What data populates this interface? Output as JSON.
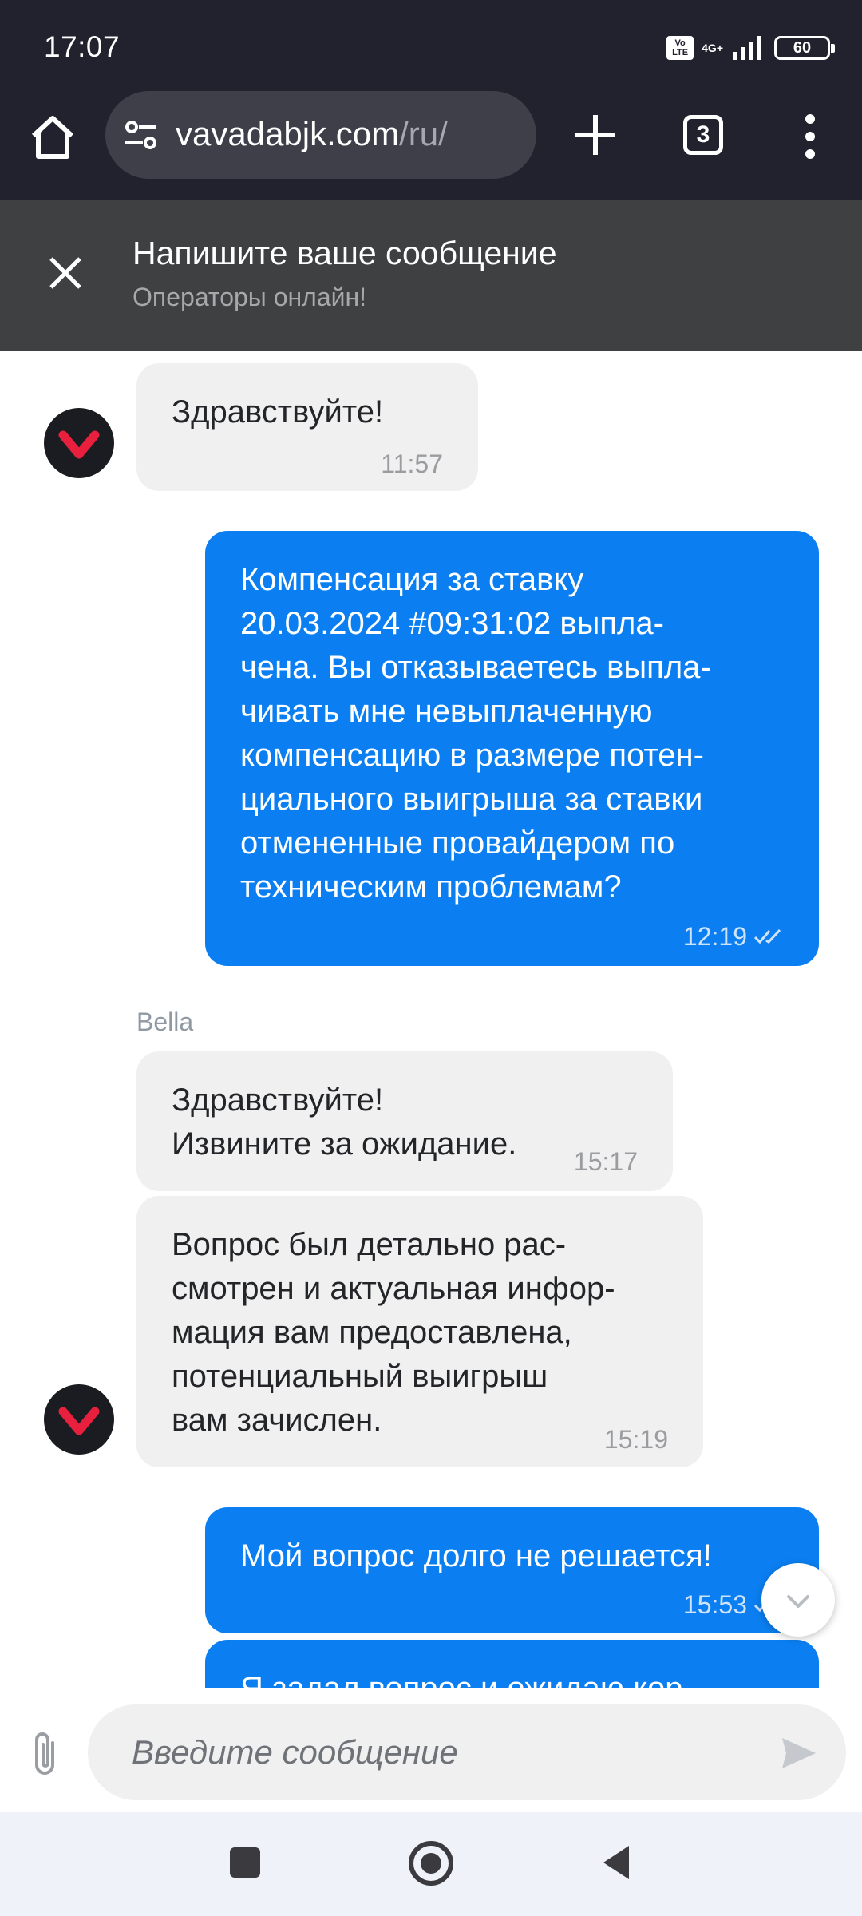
{
  "status_bar": {
    "time": "17:07",
    "volte_label": "Vo LTE",
    "network_label": "4G+",
    "battery": "60",
    "icons": [
      "volte-icon",
      "signal-icon",
      "battery-icon"
    ]
  },
  "browser": {
    "url_host": "vavadabjk.com",
    "url_path": "/ru/",
    "tab_count": "3",
    "icons": [
      "home-icon",
      "site-settings-icon",
      "plus-icon",
      "tabs-icon",
      "more-vert-icon"
    ]
  },
  "chat_header": {
    "title": "Напишите ваше сообщение",
    "subtitle": "Операторы онлайн!"
  },
  "messages": [
    {
      "direction": "in",
      "text": "Здравствуйте!",
      "time": "11:57",
      "avatar": true
    },
    {
      "direction": "out",
      "text": "Компенсация за ставку\n20.03.2024 #09:31:02 выпла-\nчена. Вы отказываетесь выпла-\nчивать мне невыплаченную\nкомпенсацию в размере потен-\nциального выигрыша за ставки\nотмененные провайдером по\nтехническим проблемам?",
      "time": "12:19",
      "read": true
    },
    {
      "direction": "in",
      "sender": "Bella",
      "text": "Здравствуйте!\nИзвините за ожидание.",
      "time": "15:17"
    },
    {
      "direction": "in",
      "text": "Вопрос был детально рас-\nсмотрен и актуальная инфор-\nмация вам предоставлена,\nпотенциальный выигрыш\nвам зачислен.",
      "time": "15:19",
      "avatar": true
    },
    {
      "direction": "out",
      "text": "Мой вопрос долго не решается!",
      "time": "15:53",
      "read": true
    },
    {
      "direction": "out",
      "text": "Я задал вопрос и ожидаю кор-",
      "time": "",
      "partial": true
    }
  ],
  "composer": {
    "placeholder": "Введите сообщение"
  },
  "colors": {
    "outgoing_bubble": "#0b7ff2",
    "incoming_bubble": "#f0f0f0",
    "header_bg": "#3e4042",
    "browser_bg": "#22222e",
    "brand_red": "#e8203d"
  }
}
